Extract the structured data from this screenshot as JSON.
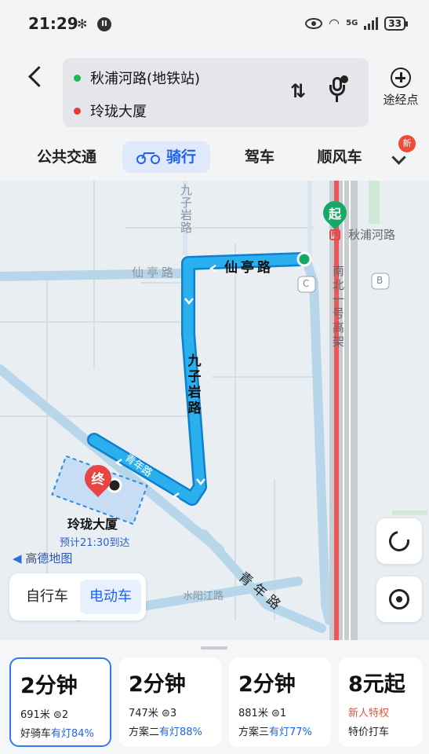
{
  "status_bar": {
    "time": "21:29",
    "net_label": "5G",
    "battery": "33",
    "app_badge": "II"
  },
  "route": {
    "start": "秋浦河路(地铁站)",
    "end": "玲珑大厦",
    "waypoint_label": "途经点"
  },
  "tabs": [
    {
      "label": "公共交通"
    },
    {
      "label": "骑行"
    },
    {
      "label": "驾车"
    },
    {
      "label": "顺风车"
    }
  ],
  "new_badge": "新",
  "map": {
    "roads": {
      "xianting_top": "仙亭路",
      "xianting_route": "仙亭路",
      "jiuziyan_top": "九子岩路",
      "jiuziyan_route": "九子岩路",
      "qingnian_small": "青年路",
      "qingnian": "青年路",
      "shuiyangjiang": "水阳江路",
      "elevated": "南北一号高架"
    },
    "station": "秋浦河路",
    "start_pin": "起",
    "end_pin": "终",
    "marker_c": "C",
    "marker_b": "B",
    "destination": "玲珑大厦",
    "eta": "预计21:30到达",
    "logo": "高德地图"
  },
  "vehicle_toggle": {
    "bicycle": "自行车",
    "ebike": "电动车",
    "selected": "电动车"
  },
  "plans": [
    {
      "time": "2分钟",
      "meta": "691米 ⊜2",
      "tag": "好骑车",
      "light": "有灯84%"
    },
    {
      "time": "2分钟",
      "meta": "747米 ⊜3",
      "tag": "方案二",
      "light": "有灯88%"
    },
    {
      "time": "2分钟",
      "meta": "881米 ⊜1",
      "tag": "方案三",
      "light": "有灯77%"
    },
    {
      "time": "8元起",
      "promo": "新人特权",
      "tag": "特价打车"
    }
  ],
  "colors": {
    "accent": "#1e63e9",
    "route": "#1aa3e8",
    "start": "#17a865",
    "end": "#e84444"
  }
}
